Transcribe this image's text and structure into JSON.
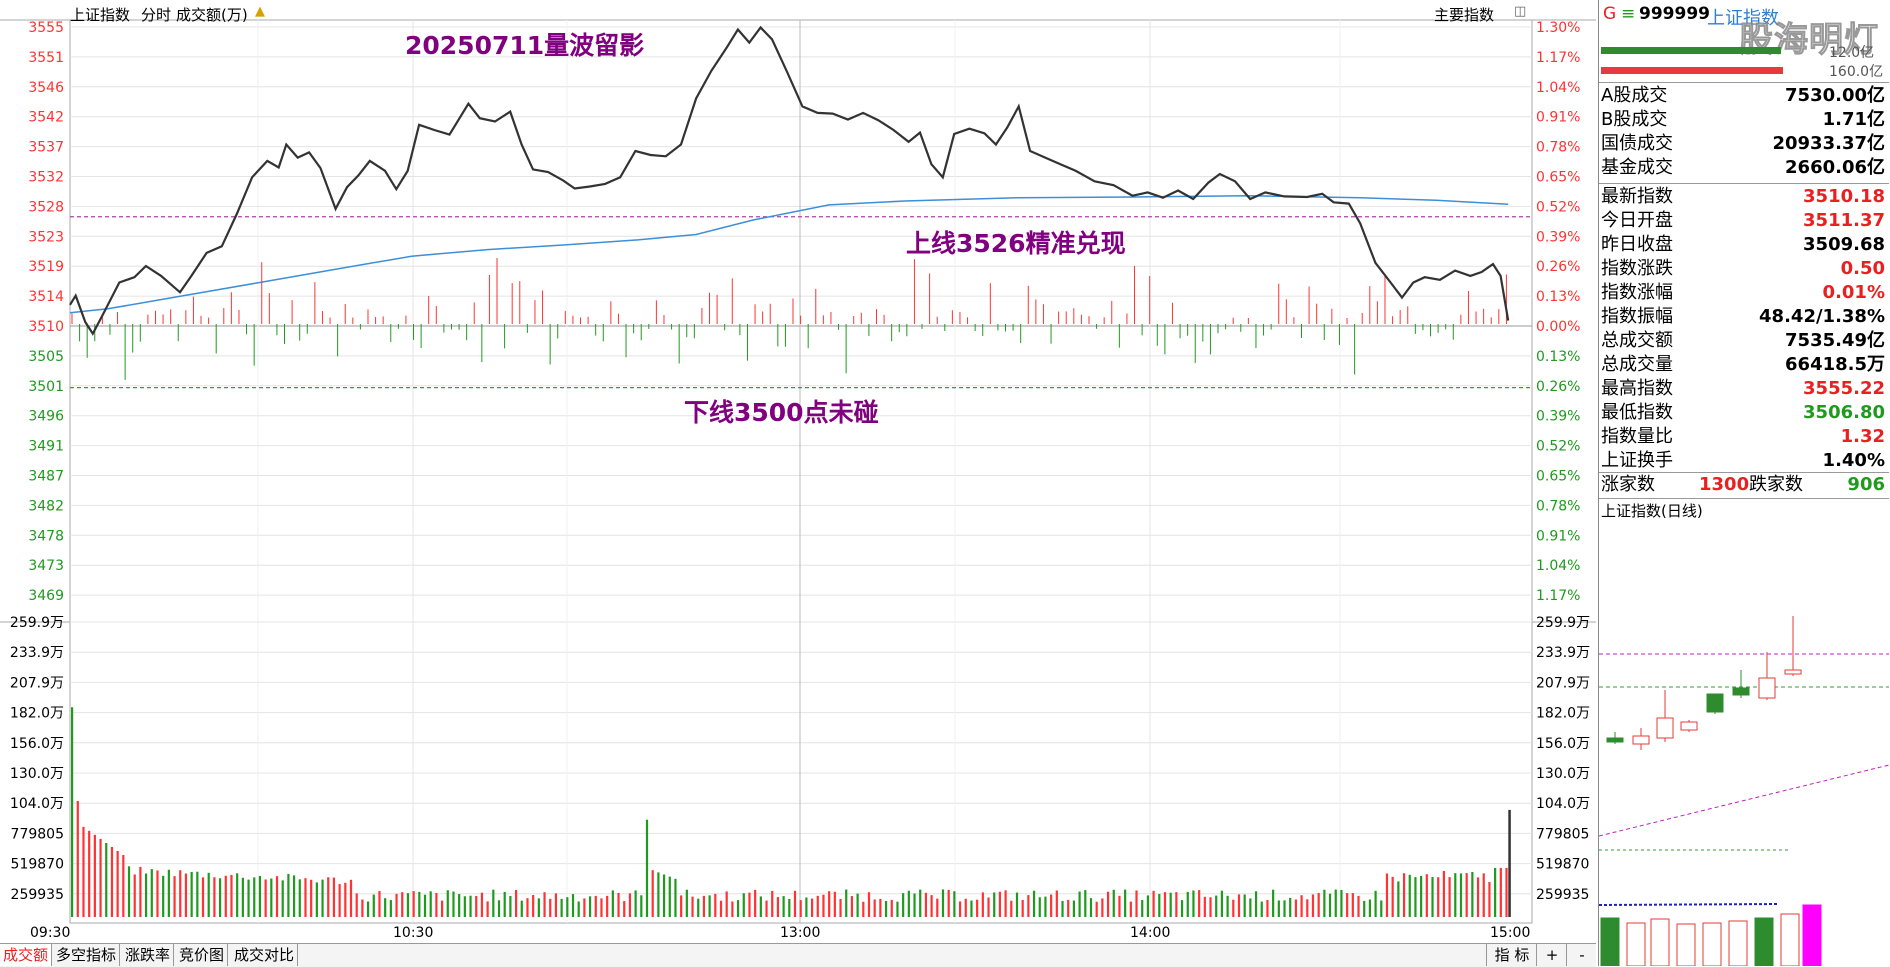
{
  "header": {
    "index_name": "上证指数",
    "mode": "分时",
    "indicator": "成交额(万)",
    "main_indicator_btn": "主要指数"
  },
  "annotations": {
    "title": "20250711量波留影",
    "upper": "上线3526精准兑现",
    "lower": "下线3500点未碰"
  },
  "watermark": "股海明灯",
  "price_axis": {
    "left_labels": [
      "3555",
      "3551",
      "3546",
      "3542",
      "3537",
      "3532",
      "3528",
      "3523",
      "3519",
      "3514",
      "3510",
      "3505",
      "3501",
      "3496",
      "3491",
      "3487",
      "3482",
      "3478",
      "3473",
      "3469"
    ],
    "right_labels": [
      "1.30%",
      "1.17%",
      "1.04%",
      "0.91%",
      "0.78%",
      "0.65%",
      "0.52%",
      "0.39%",
      "0.26%",
      "0.13%",
      "0.00%",
      "0.13%",
      "0.26%",
      "0.39%",
      "0.52%",
      "0.65%",
      "0.78%",
      "0.91%",
      "1.04%",
      "1.17%"
    ],
    "ticks_prices": [
      3555.22,
      3550.66,
      3546.12,
      3541.58,
      3537.02,
      3532.48,
      3527.94,
      3523.39,
      3518.85,
      3514.3,
      3509.68,
      3505.21,
      3500.66,
      3496.12,
      3491.58,
      3487.03,
      3482.48,
      3477.94,
      3473.39,
      3468.85
    ]
  },
  "volume_axis": {
    "labels": [
      "259.9万",
      "233.9万",
      "207.9万",
      "182.0万",
      "156.0万",
      "130.0万",
      "104.0万",
      "779805",
      "519870",
      "259935"
    ]
  },
  "time_axis": [
    "09:30",
    "10:30",
    "13:00",
    "14:00",
    "15:00"
  ],
  "colors": {
    "up": "#ff3333",
    "down": "#1f9a1f",
    "price_line": "#333333",
    "avg_line": "#3c8fd8",
    "annot": "#800080",
    "right_label": "#ff3333",
    "left_up": "#ff3333",
    "left_down": "#1f9a1f"
  },
  "right_panel": {
    "code_flag": "G",
    "code_menu": "≡",
    "code": "999999",
    "name": "上证指数",
    "bar_top_label": "12.0亿",
    "bar_bottom_label": "160.0亿",
    "turnover": [
      {
        "label": "A股成交",
        "value": "7530.00亿",
        "color": "#000"
      },
      {
        "label": "B股成交",
        "value": "1.71亿",
        "color": "#000"
      },
      {
        "label": "国债成交",
        "value": "20933.37亿",
        "color": "#000"
      },
      {
        "label": "基金成交",
        "value": "2660.06亿",
        "color": "#000"
      }
    ],
    "stats": [
      {
        "label": "最新指数",
        "value": "3510.18",
        "color": "#e82020"
      },
      {
        "label": "今日开盘",
        "value": "3511.37",
        "color": "#e82020"
      },
      {
        "label": "昨日收盘",
        "value": "3509.68",
        "color": "#000"
      },
      {
        "label": "指数涨跌",
        "value": "0.50",
        "color": "#e82020"
      },
      {
        "label": "指数涨幅",
        "value": "0.01%",
        "color": "#e82020"
      },
      {
        "label": "指数振幅",
        "value": "48.42/1.38%",
        "color": "#000"
      },
      {
        "label": "总成交额",
        "value": "7535.49亿",
        "color": "#000"
      },
      {
        "label": "总成交量",
        "value": "66418.5万",
        "color": "#000"
      },
      {
        "label": "最高指数",
        "value": "3555.22",
        "color": "#e82020"
      },
      {
        "label": "最低指数",
        "value": "3506.80",
        "color": "#1f9a1f"
      },
      {
        "label": "指数量比",
        "value": "1.32",
        "color": "#e82020"
      },
      {
        "label": "上证换手",
        "value": "1.40%",
        "color": "#000"
      }
    ],
    "breadth": {
      "up_label": "涨家数",
      "up_value": "1300",
      "down_label": "跌家数",
      "down_value": "906"
    },
    "mini_title": "上证指数(日线)"
  },
  "bottom_tabs": [
    "成交额",
    "多空指标",
    "涨跌率",
    "竞价图",
    "成交对比"
  ],
  "bottom_controls": {
    "indicator": "指 标",
    "plus": "+",
    "minus": "-"
  }
}
